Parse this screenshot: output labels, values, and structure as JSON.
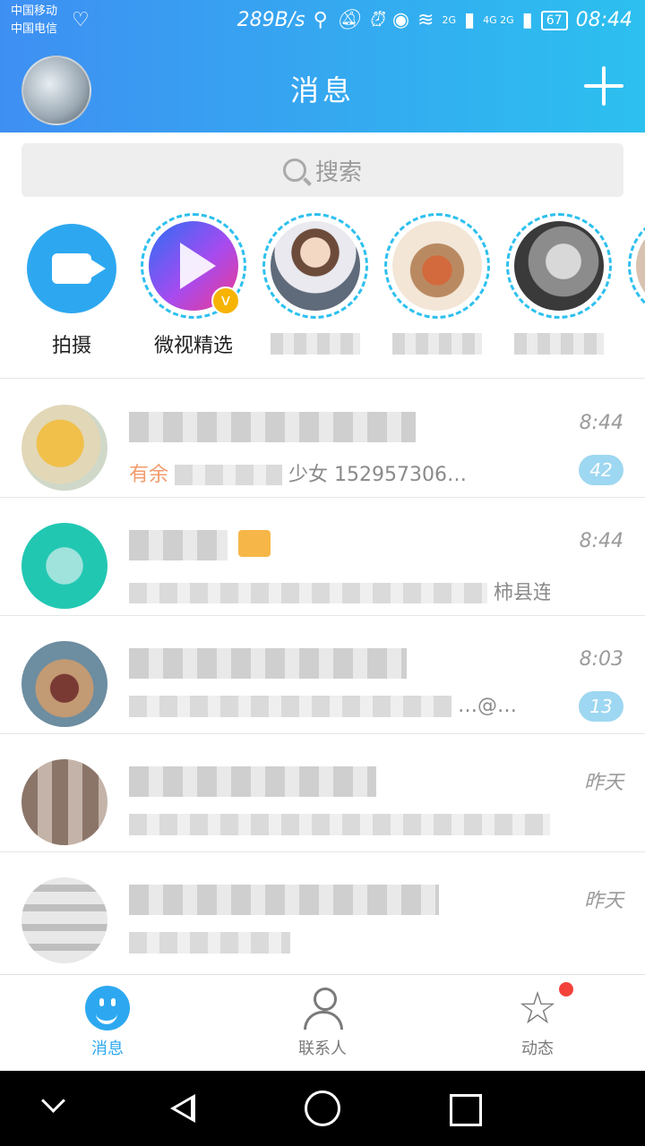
{
  "status_bar": {
    "carrier1": "中国移动",
    "carrier2": "中国电信",
    "speed": "289B/s",
    "net1": "2G",
    "net2": "4G 2G",
    "battery": "67",
    "time": "08:44"
  },
  "header": {
    "title": "消息",
    "add_icon": "plus-icon"
  },
  "search": {
    "placeholder": "搜索"
  },
  "stories": [
    {
      "label": "拍摄",
      "type": "camera"
    },
    {
      "label": "微视精选",
      "type": "weishi"
    },
    {
      "label": "",
      "type": "user"
    },
    {
      "label": "",
      "type": "user"
    },
    {
      "label": "",
      "type": "user"
    }
  ],
  "chats": [
    {
      "time": "8:44",
      "preview_visible": "有余",
      "preview_tail": "少女 152957306…",
      "unread": "42"
    },
    {
      "time": "8:44",
      "preview_visible": "",
      "preview_tail": "柿县连…",
      "unread": ""
    },
    {
      "time": "8:03",
      "preview_visible": "",
      "preview_tail": "…@…",
      "unread": "13"
    },
    {
      "time": "昨天",
      "preview_visible": "",
      "preview_tail": "",
      "unread": ""
    },
    {
      "time": "昨天",
      "preview_visible": "",
      "preview_tail": "",
      "unread": ""
    }
  ],
  "bottom_nav": {
    "messages": "消息",
    "contacts": "联系人",
    "moments": "动态"
  },
  "colors": {
    "accent": "#2da8f0",
    "header_start": "#3e8ff2",
    "header_end": "#2cc0ef",
    "unread_badge": "#9ed7f1",
    "notification_dot": "#f2423a"
  }
}
